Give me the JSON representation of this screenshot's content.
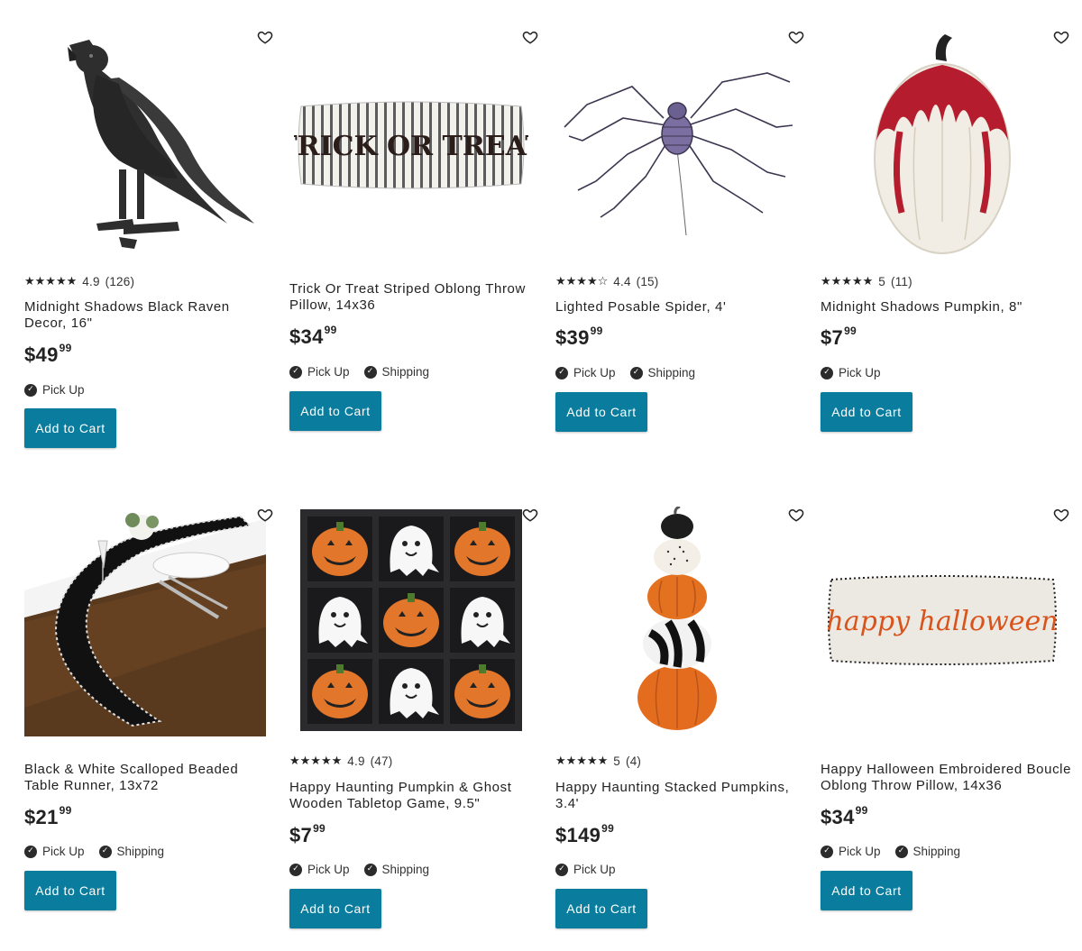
{
  "products": [
    {
      "title": "Midnight Shadows Black Raven Decor, 16\"",
      "rating": "4.9",
      "reviews": "(126)",
      "price_main": "$49",
      "price_cents": "99",
      "pickup": "Pick Up",
      "shipping": "",
      "button": "Add to Cart"
    },
    {
      "title": "Trick Or Treat Striped Oblong Throw Pillow, 14x36",
      "rating": "",
      "reviews": "",
      "price_main": "$34",
      "price_cents": "99",
      "pickup": "Pick Up",
      "shipping": "Shipping",
      "button": "Add to Cart",
      "pillow_text": "TRICK OR TREAT"
    },
    {
      "title": "Lighted Posable Spider, 4'",
      "rating": "4.4",
      "reviews": "(15)",
      "price_main": "$39",
      "price_cents": "99",
      "pickup": "Pick Up",
      "shipping": "Shipping",
      "button": "Add to Cart"
    },
    {
      "title": "Midnight Shadows Pumpkin, 8\"",
      "rating": "5",
      "reviews": "(11)",
      "price_main": "$7",
      "price_cents": "99",
      "pickup": "Pick Up",
      "shipping": "",
      "button": "Add to Cart"
    },
    {
      "title": "Black & White Scalloped Beaded Table Runner, 13x72",
      "rating": "",
      "reviews": "",
      "price_main": "$21",
      "price_cents": "99",
      "pickup": "Pick Up",
      "shipping": "Shipping",
      "button": "Add to Cart"
    },
    {
      "title": "Happy Haunting Pumpkin & Ghost Wooden Tabletop Game, 9.5\"",
      "rating": "4.9",
      "reviews": "(47)",
      "price_main": "$7",
      "price_cents": "99",
      "pickup": "Pick Up",
      "shipping": "Shipping",
      "button": "Add to Cart"
    },
    {
      "title": "Happy Haunting Stacked Pumpkins, 3.4'",
      "rating": "5",
      "reviews": "(4)",
      "price_main": "$149",
      "price_cents": "99",
      "pickup": "Pick Up",
      "shipping": "",
      "button": "Add to Cart"
    },
    {
      "title": "Happy Halloween Embroidered Boucle Oblong Throw Pillow, 14x36",
      "rating": "",
      "reviews": "",
      "price_main": "$34",
      "price_cents": "99",
      "pickup": "Pick Up",
      "shipping": "Shipping",
      "button": "Add to Cart",
      "pillow_text": "happy halloween"
    }
  ],
  "colors": {
    "button": "#0a7d9e",
    "text": "#222222"
  },
  "icons": {
    "favorite": "heart-outline-icon",
    "available": "check-circle-icon",
    "rating": "star-icon"
  }
}
